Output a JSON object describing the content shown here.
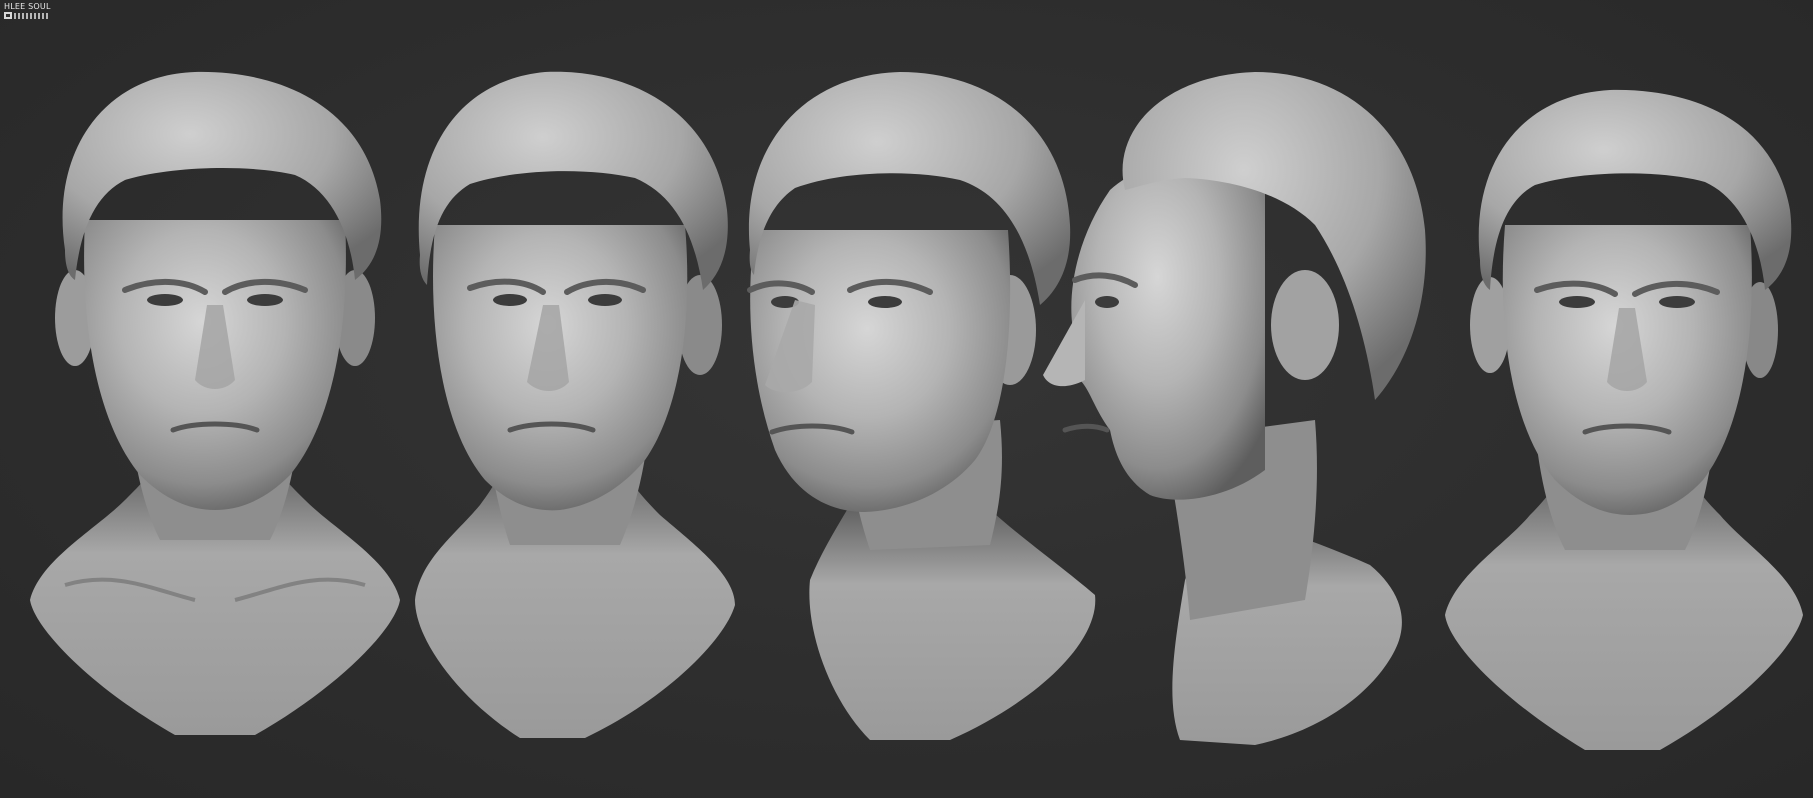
{
  "watermark": {
    "line1": "HLEE SOUL",
    "icon": "studio-logo-mark"
  },
  "scene": {
    "background_color": "#2e2e2e",
    "sculpt_color": "#b9b9b9",
    "views": [
      {
        "name": "front-view"
      },
      {
        "name": "three-quarter-left-view"
      },
      {
        "name": "three-quarter-view"
      },
      {
        "name": "side-profile-view"
      },
      {
        "name": "front-right-view"
      }
    ]
  }
}
